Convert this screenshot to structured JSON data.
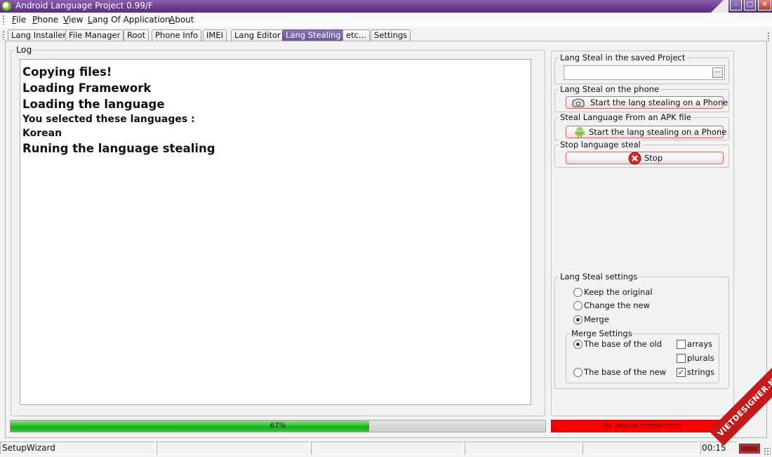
{
  "window": {
    "title": "Android Language Project 0.99/F"
  },
  "menu": [
    {
      "label": "File",
      "accel": "F",
      "rest": "ile"
    },
    {
      "label": "Phone",
      "accel": "P",
      "rest": "hone"
    },
    {
      "label": "View",
      "accel": "V",
      "rest": "iew"
    },
    {
      "label": "Lang Of Application",
      "accel": "L",
      "rest": "ang Of Application"
    },
    {
      "label": "About",
      "accel": "A",
      "rest": "bout"
    }
  ],
  "tabs": [
    {
      "label": "Lang Installer",
      "active": false
    },
    {
      "label": "File Manager",
      "active": false
    },
    {
      "label": "Root",
      "active": false
    },
    {
      "label": "Phone Info",
      "active": false
    },
    {
      "label": "IMEI",
      "active": false
    },
    {
      "label": "Lang Editor",
      "active": false
    },
    {
      "label": "Lang Stealing",
      "active": true
    },
    {
      "label": "etc...",
      "active": false
    },
    {
      "label": "Settings",
      "active": false
    }
  ],
  "log": {
    "title": "Log",
    "lines": [
      "Copying files!",
      "Loading Framework",
      "Loading the language",
      "You selected these languages :",
      "Korean",
      "Runing the language stealing"
    ]
  },
  "steal_saved": {
    "title": "Lang Steal in the saved Project",
    "value": "",
    "browse_label": "..."
  },
  "steal_phone": {
    "title": "Lang Steal on the phone",
    "button_label": "Start the lang stealing on a Phone",
    "icon": "phone-icon"
  },
  "steal_apk": {
    "title": "Steal Language From an APK file",
    "button_label": "Start the lang stealing on a Phone",
    "icon": "android-icon"
  },
  "stop": {
    "title": "Stop language steal",
    "button_label": "Stop",
    "icon": "stop-icon"
  },
  "settings": {
    "title": "Lang Steal settings",
    "modes": [
      {
        "label": "Keep the original",
        "selected": false
      },
      {
        "label": "Change the new",
        "selected": false
      },
      {
        "label": "Merge",
        "selected": true
      }
    ],
    "merge": {
      "title": "Merge Settings",
      "base_options": [
        {
          "label": "The base of the old",
          "selected": true
        },
        {
          "label": "The base of the new",
          "selected": false
        }
      ],
      "resource_types": [
        {
          "label": "arrays",
          "checked": false
        },
        {
          "label": "plurals",
          "checked": false
        },
        {
          "label": "strings",
          "checked": true
        }
      ]
    }
  },
  "progress": {
    "percent": 67,
    "text": "67%"
  },
  "phone_status": {
    "text": "No phone connected!",
    "color": "#ff0000"
  },
  "statusbar": {
    "panel1": "SetupWizard",
    "time": "00:15"
  },
  "watermark": "VIETDESIGNER.NET",
  "colors": {
    "title_bar": "#6a3f8f",
    "active_tab": "#7a62a6",
    "progress_fill": "#2db52d",
    "button_border": "#c06a6a"
  }
}
